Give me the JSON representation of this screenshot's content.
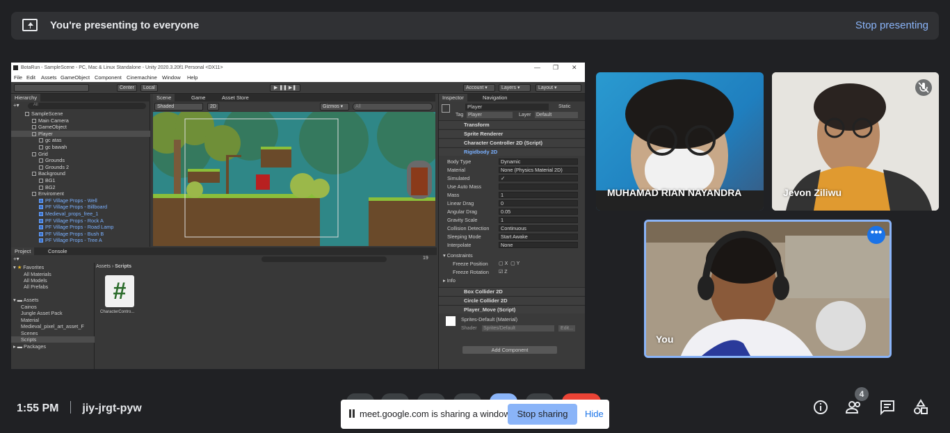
{
  "banner": {
    "title": "You're presenting to everyone",
    "stop": "Stop presenting"
  },
  "unity": {
    "title": "BotaRun - SampleScene - PC, Mac & Linux Standalone - Unity 2020.3.20f1 Personal <DX11>",
    "menu": [
      "File",
      "Edit",
      "Assets",
      "GameObject",
      "Component",
      "Cinemachine",
      "Window",
      "Help"
    ],
    "toolbar": {
      "center": "Center",
      "local": "Local",
      "account": "Account",
      "layers": "Layers",
      "layout": "Layout"
    },
    "hierarchy": {
      "tab": "Hierarchy",
      "search": "All",
      "rows": [
        {
          "label": "SampleScene",
          "indent": 0,
          "blue": false
        },
        {
          "label": "Main Camera",
          "indent": 1,
          "blue": false
        },
        {
          "label": "GameObject",
          "indent": 1,
          "blue": false
        },
        {
          "label": "Player",
          "indent": 1,
          "blue": false,
          "sel": true
        },
        {
          "label": "gc atas",
          "indent": 2,
          "blue": false
        },
        {
          "label": "gc bawah",
          "indent": 2,
          "blue": false
        },
        {
          "label": "Grid",
          "indent": 1,
          "blue": false
        },
        {
          "label": "Grounds",
          "indent": 2,
          "blue": false
        },
        {
          "label": "Grounds 2",
          "indent": 2,
          "blue": false
        },
        {
          "label": "Background",
          "indent": 1,
          "blue": false
        },
        {
          "label": "BG1",
          "indent": 2,
          "blue": false
        },
        {
          "label": "BG2",
          "indent": 2,
          "blue": false
        },
        {
          "label": "Enviroment",
          "indent": 1,
          "blue": false
        },
        {
          "label": "PF Village Props - Well",
          "indent": 2,
          "blue": true
        },
        {
          "label": "PF Village Props - Billboard",
          "indent": 2,
          "blue": true
        },
        {
          "label": "Medieval_props_free_1",
          "indent": 2,
          "blue": true
        },
        {
          "label": "PF Village Props - Rock A",
          "indent": 2,
          "blue": true
        },
        {
          "label": "PF Village Props - Road Lamp",
          "indent": 2,
          "blue": true
        },
        {
          "label": "PF Village Props - Bush B",
          "indent": 2,
          "blue": true
        },
        {
          "label": "PF Village Props - Tree A",
          "indent": 2,
          "blue": true
        }
      ]
    },
    "scene": {
      "tabs": [
        "Scene",
        "Game",
        "Asset Store"
      ],
      "shaded": "Shaded",
      "mode": "2D",
      "gizmos": "Gizmos",
      "search": "All"
    },
    "project": {
      "tabs": [
        "Project",
        "Console"
      ],
      "breadcrumb": [
        "Assets",
        "Scripts"
      ],
      "favorites": "Favorites",
      "fav_items": [
        "All Materials",
        "All Models",
        "All Prefabs"
      ],
      "assets": "Assets",
      "asset_items": [
        "Cainos",
        "Jungle Asset Pack",
        "Material",
        "Medieval_pixel_art_asset_F",
        "Scenes",
        "Scripts"
      ],
      "packages": "Packages",
      "file": "CharacterContro...",
      "count": "19"
    },
    "inspector": {
      "tabs": [
        "Inspector",
        "Navigation"
      ],
      "name": "Player",
      "static": "Static",
      "tag_label": "Tag",
      "tag": "Player",
      "layer_label": "Layer",
      "layer": "Default",
      "components": [
        "Transform",
        "Sprite Renderer",
        "Character Controller 2D (Script)",
        "Rigidbody 2D"
      ],
      "props": [
        {
          "label": "Body Type",
          "value": "Dynamic"
        },
        {
          "label": "Material",
          "value": "None (Physics Material 2D)"
        },
        {
          "label": "Simulated",
          "value": "✓"
        },
        {
          "label": "Use Auto Mass",
          "value": ""
        },
        {
          "label": "Mass",
          "value": "1"
        },
        {
          "label": "Linear Drag",
          "value": "0"
        },
        {
          "label": "Angular Drag",
          "value": "0.05"
        },
        {
          "label": "Gravity Scale",
          "value": "1"
        },
        {
          "label": "Collision Detection",
          "value": "Continuous"
        },
        {
          "label": "Sleeping Mode",
          "value": "Start Awake"
        },
        {
          "label": "Interpolate",
          "value": "None"
        }
      ],
      "constraints": "Constraints",
      "freeze_pos": "Freeze Position",
      "freeze_rot": "Freeze Rotation",
      "x": "X",
      "y": "Y",
      "z": "Z",
      "info": "Info",
      "components2": [
        "Box Collider 2D",
        "Circle Collider 2D",
        "Player_Move (Script)"
      ],
      "material": "Sprites-Default (Material)",
      "shader_label": "Shader",
      "shader": "Sprites/Default",
      "edit": "Edit...",
      "add": "Add Component"
    }
  },
  "participants": [
    {
      "name": "MUHAMAD RIAN NAYANDRA"
    },
    {
      "name": "Jevon Ziliwu"
    },
    {
      "name": "You"
    }
  ],
  "bottom": {
    "time": "1:55 PM",
    "code": "jiy-jrgt-pyw",
    "people_count": "4",
    "share_text": "meet.google.com is sharing a window.",
    "stop_sharing": "Stop sharing",
    "hide": "Hide"
  },
  "colors": {
    "bg": "#202124",
    "link": "#8ab4f8",
    "active_border": "#8ab4f8"
  }
}
